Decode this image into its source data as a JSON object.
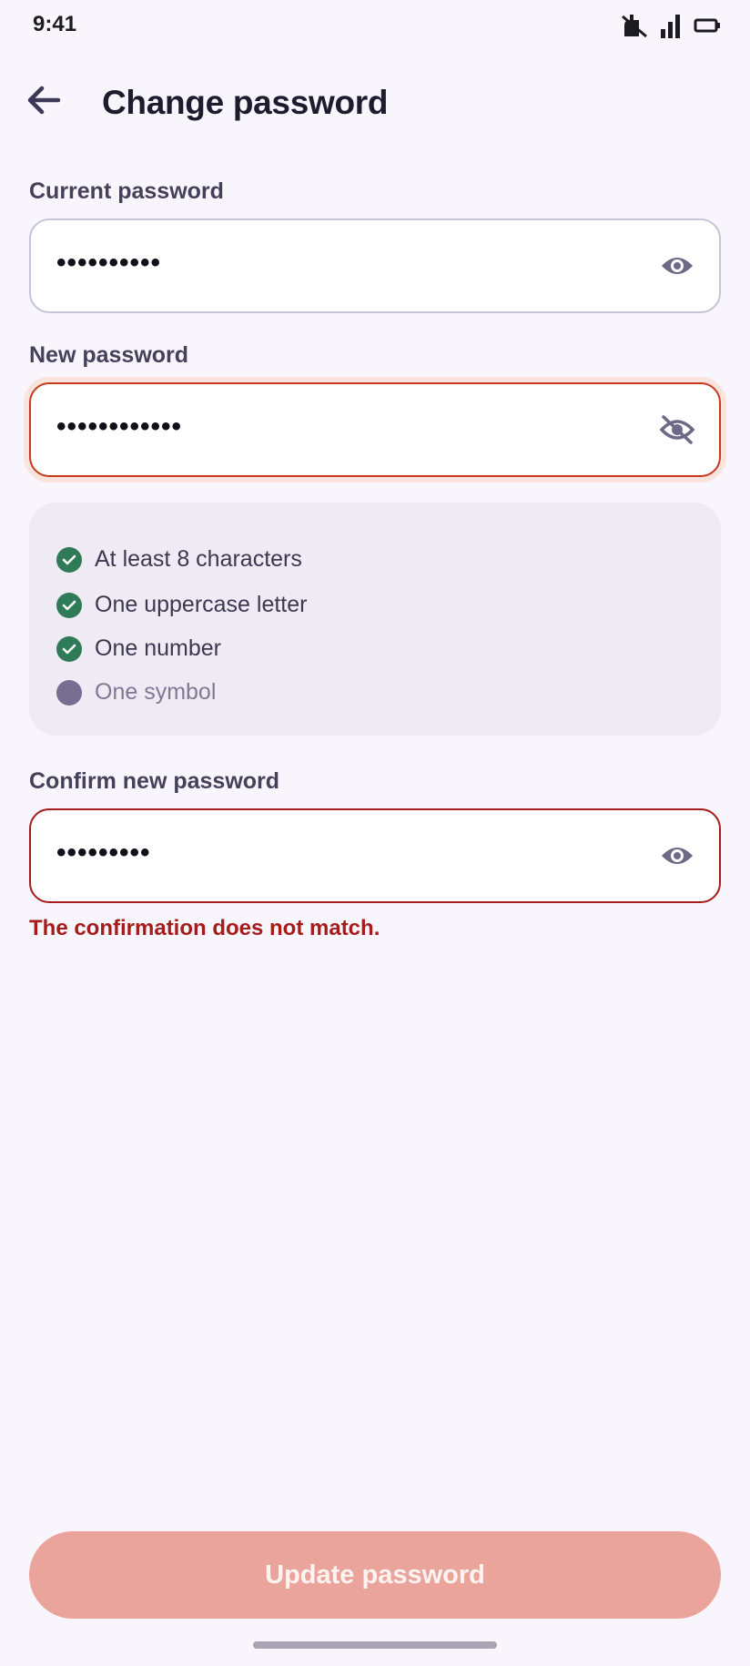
{
  "status_bar": {
    "time": "9:41",
    "icons": [
      "notification-off-icon",
      "signal-icon",
      "battery-icon"
    ]
  },
  "header": {
    "title": "Change password",
    "back_icon": "arrow-left-icon"
  },
  "fields": {
    "current": {
      "label": "Current password",
      "value": "••••••••••",
      "toggle_icon": "eye-icon"
    },
    "new": {
      "label": "New password",
      "value": "••••••••••••",
      "toggle_icon": "eye-off-icon"
    },
    "confirm": {
      "label": "Confirm new password",
      "value": "•••••••••",
      "toggle_icon": "eye-icon",
      "error": "The confirmation does not match."
    }
  },
  "requirements": [
    {
      "text": "At least 8 characters",
      "met": true
    },
    {
      "text": "One uppercase letter",
      "met": true
    },
    {
      "text": "One number",
      "met": true
    },
    {
      "text": "One symbol",
      "met": false
    }
  ],
  "submit": {
    "label": "Update password"
  },
  "colors": {
    "background": "#f8f6fc",
    "met": "#2f7a57",
    "unmet": "#776d90",
    "error": "#a61c1c",
    "button_disabled": "#eba49b"
  }
}
